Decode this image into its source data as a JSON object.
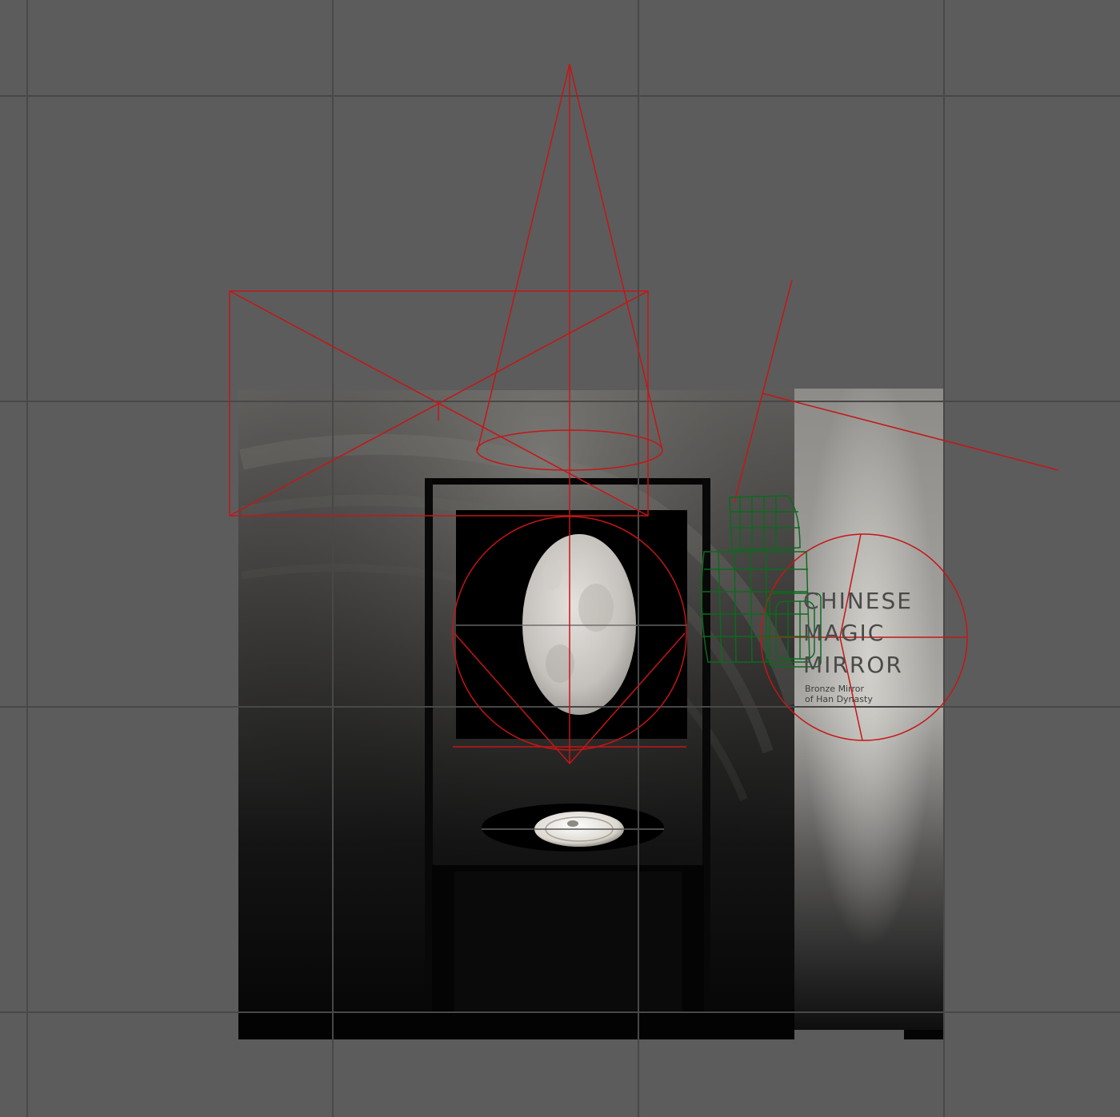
{
  "viewport": {
    "background_color": "#5c5c5c",
    "grid_color": "#454545",
    "light_gizmo_color": "#c41616",
    "camera_gizmo_color": "#0c6a1e"
  },
  "poster": {
    "title_lines": [
      "CHINESE",
      "MAGIC",
      "MIRROR"
    ],
    "subtitle_lines": [
      "Bronze Mirror",
      "of Han Dynasty"
    ]
  },
  "icons": {
    "spot_light": "spot-light-cone-icon",
    "area_light": "area-light-rectangle-icon",
    "point_light": "point-light-sphere-icon",
    "camera": "camera-wireframe-icon"
  }
}
